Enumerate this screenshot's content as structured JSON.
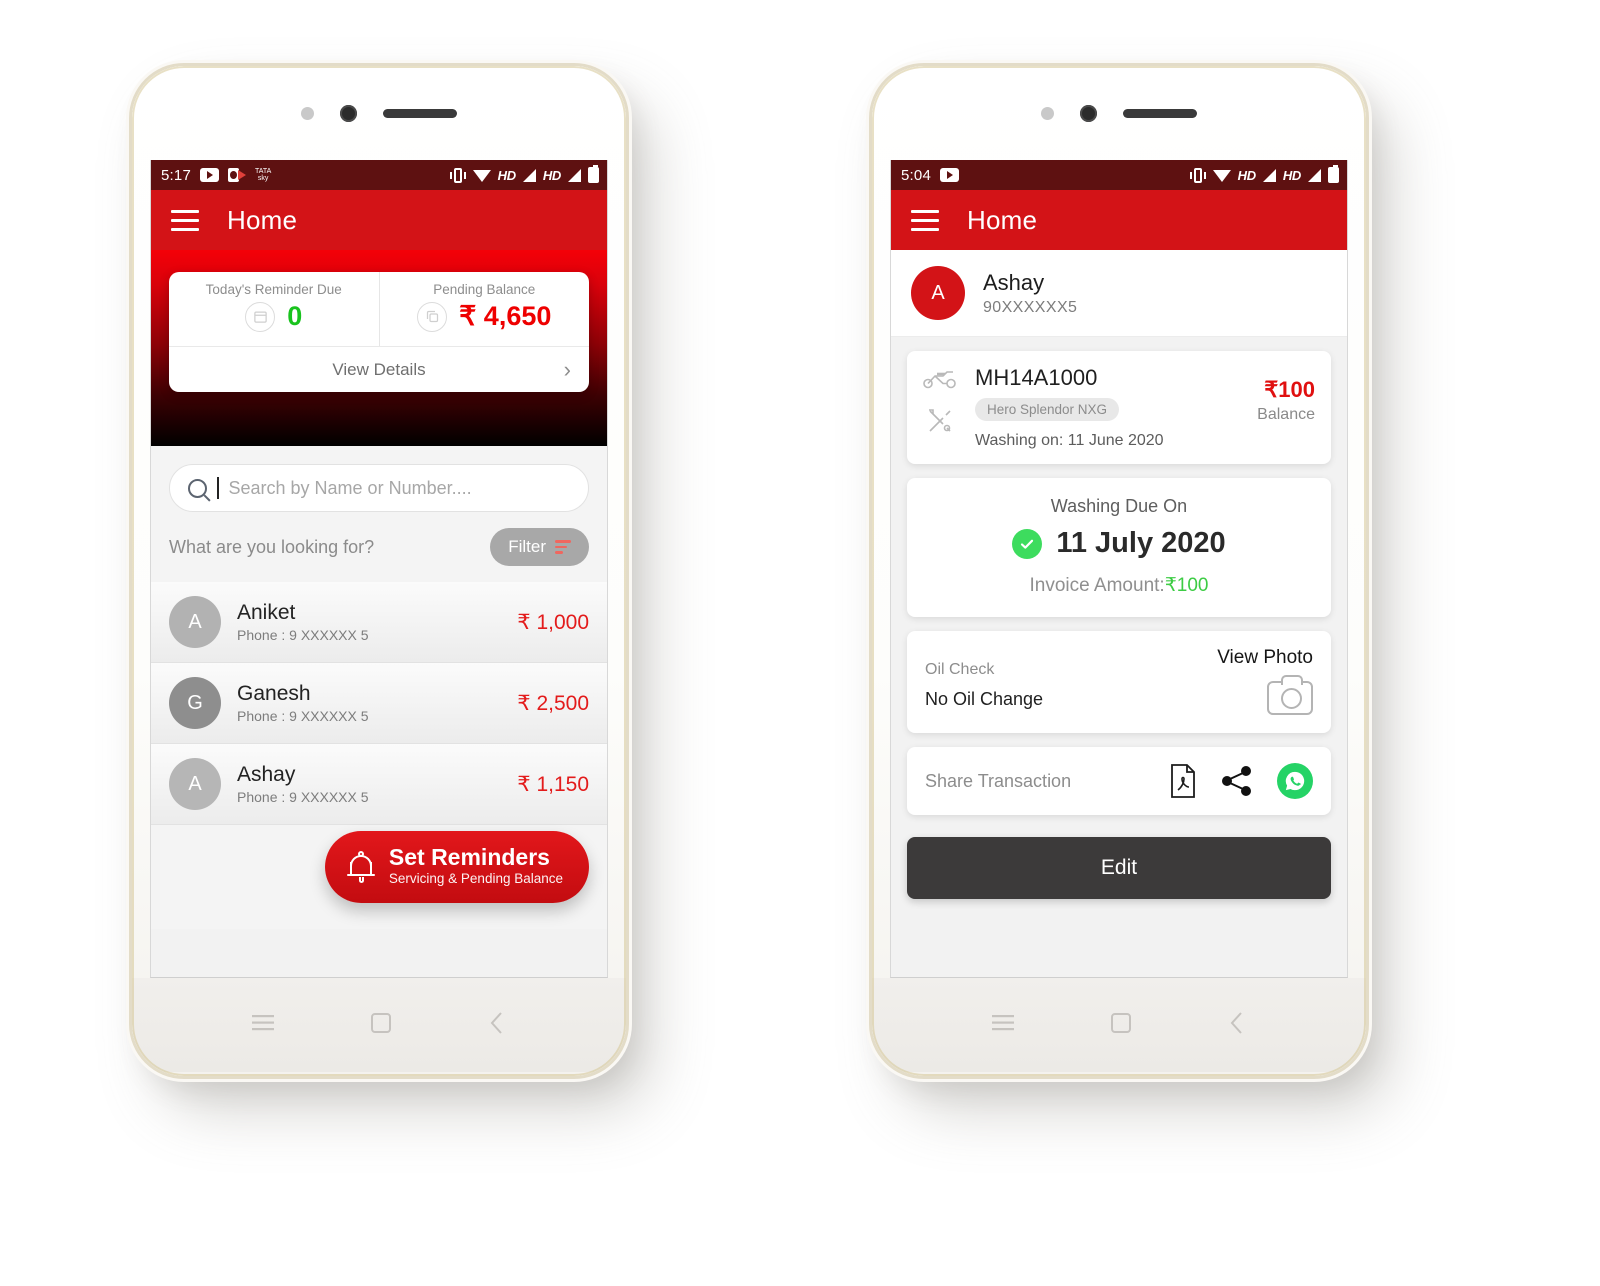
{
  "phone1": {
    "status_bar": {
      "time": "5:17",
      "icons": [
        "youtube-icon",
        "camera-app-icon",
        "tata-sky-icon"
      ],
      "tata_line1": "TATA",
      "tata_line2": "sky",
      "right_icons": [
        "vibrate-icon",
        "wifi-icon",
        "hd-label",
        "signal-icon",
        "hd-label",
        "signal-icon",
        "battery-icon"
      ],
      "hd_label": "HD"
    },
    "appbar": {
      "title": "Home",
      "menu_icon": "hamburger-icon"
    },
    "summary": {
      "reminder_label": "Today's Reminder Due",
      "reminder_value": "0",
      "reminder_icon": "calendar-icon",
      "balance_label": "Pending Balance",
      "balance_value": "₹ 4,650",
      "balance_icon": "copy-icon",
      "view_details": "View Details",
      "chevron": "›"
    },
    "search": {
      "placeholder": "Search by Name or Number....",
      "value": "",
      "icon": "search-icon"
    },
    "filter": {
      "prompt": "What are you looking for?",
      "button_label": "Filter",
      "icon": "filter-icon"
    },
    "contacts": [
      {
        "initial": "A",
        "name": "Aniket",
        "phone": "Phone : 9 XXXXXX 5",
        "amount": "₹ 1,000"
      },
      {
        "initial": "G",
        "name": "Ganesh",
        "phone": "Phone : 9 XXXXXX 5",
        "amount": "₹ 2,500"
      },
      {
        "initial": "A",
        "name": "Ashay",
        "phone": "Phone : 9 XXXXXX 5",
        "amount": "₹ 1,150"
      }
    ],
    "fab": {
      "title": "Set Reminders",
      "subtitle": "Servicing & Pending Balance",
      "icon": "bell-icon"
    },
    "nav": {
      "recents": "recents-icon",
      "home": "home-icon",
      "back": "back-icon"
    }
  },
  "phone2": {
    "status_bar": {
      "time": "5:04",
      "icons": [
        "youtube-icon"
      ],
      "right_icons": [
        "vibrate-icon",
        "wifi-icon",
        "hd-label",
        "signal-icon",
        "hd-label",
        "signal-icon",
        "battery-icon"
      ],
      "hd_label": "HD"
    },
    "appbar": {
      "title": "Home",
      "menu_icon": "hamburger-icon"
    },
    "user": {
      "initial": "A",
      "name": "Ashay",
      "phone": "90XXXXXX5"
    },
    "vehicle": {
      "plate": "MH14A1000",
      "model_tag": "Hero Splendor NXG",
      "service_line": "Washing on: 11 June 2020",
      "amount": "₹100",
      "amount_label": "Balance",
      "bike_icon": "motorcycle-icon",
      "tools_icon": "tools-icon"
    },
    "due": {
      "label": "Washing Due On",
      "date": "11 July 2020",
      "invoice_prefix": "Invoice Amount:",
      "invoice_amount": "₹100",
      "status_icon": "check-circle-icon"
    },
    "oil": {
      "label": "Oil Check",
      "value": "No Oil Change",
      "view_photo": "View Photo",
      "camera_icon": "camera-icon"
    },
    "share": {
      "label": "Share Transaction",
      "icons": [
        "pdf-icon",
        "share-nodes-icon",
        "whatsapp-icon"
      ]
    },
    "edit_button": "Edit",
    "nav": {
      "recents": "recents-icon",
      "home": "home-icon",
      "back": "back-icon"
    }
  },
  "colors": {
    "brand_red": "#d31317",
    "status_bar": "#5e1111",
    "amount_red": "#e31b1b",
    "green": "#19c31e",
    "whatsapp": "#25d366",
    "dark_button": "#3c3a3a"
  }
}
